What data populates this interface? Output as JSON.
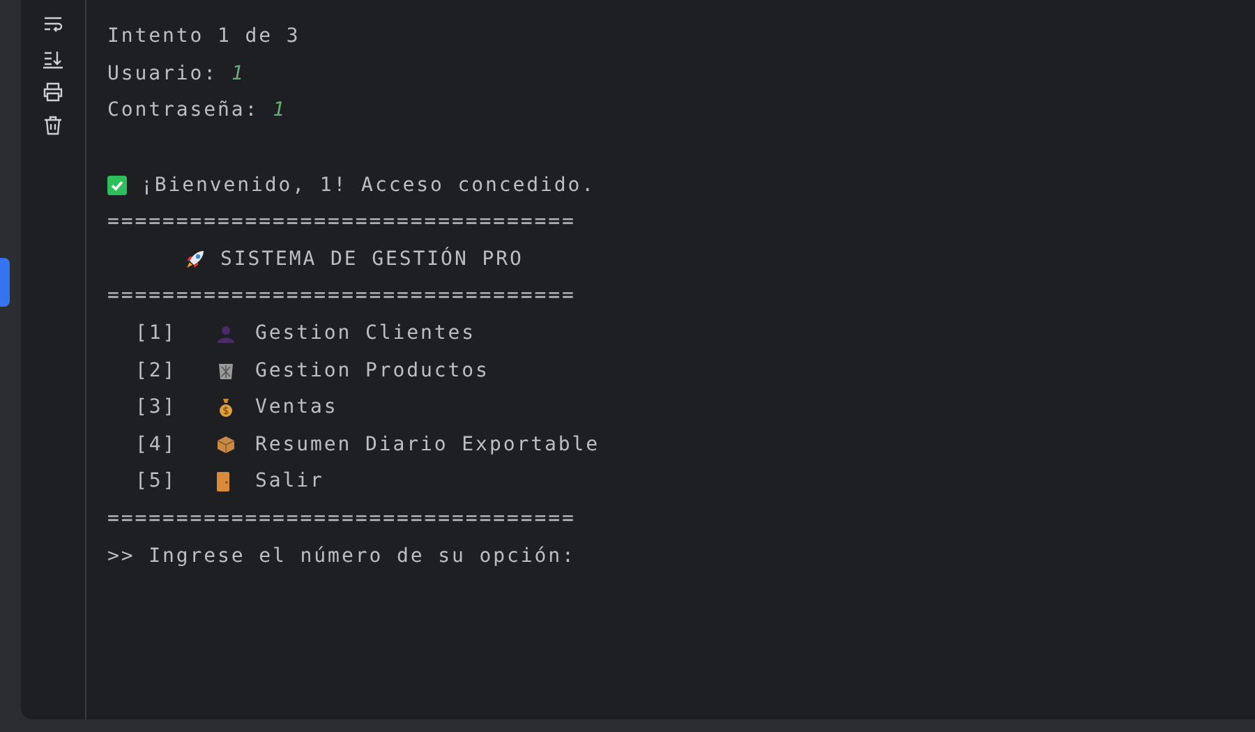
{
  "console": {
    "lines": [
      {
        "kind": "text",
        "text": "Intento 1 de 3"
      },
      {
        "kind": "input",
        "label": "Usuario:",
        "value": "1"
      },
      {
        "kind": "input",
        "label": "Contraseña:",
        "value": "1"
      },
      {
        "kind": "blank"
      },
      {
        "kind": "success",
        "text": "¡Bienvenido, 1! Acceso concedido."
      },
      {
        "kind": "rule",
        "text": "=================================="
      },
      {
        "kind": "title",
        "text": "SISTEMA DE GESTIÓN PRO"
      },
      {
        "kind": "rule",
        "text": "=================================="
      },
      {
        "kind": "menu",
        "number": "[1]",
        "text": "Gestion Clientes"
      },
      {
        "kind": "menu",
        "number": "[2]",
        "text": "Gestion Productos"
      },
      {
        "kind": "menu",
        "number": "[3]",
        "text": "Ventas"
      },
      {
        "kind": "menu",
        "number": "[4]",
        "text": "Resumen Diario Exportable"
      },
      {
        "kind": "menu",
        "number": "[5]",
        "text": "Salir"
      },
      {
        "kind": "rule",
        "text": "=================================="
      },
      {
        "kind": "prompt",
        "text": ">> Ingrese el número de su opción:"
      }
    ]
  }
}
